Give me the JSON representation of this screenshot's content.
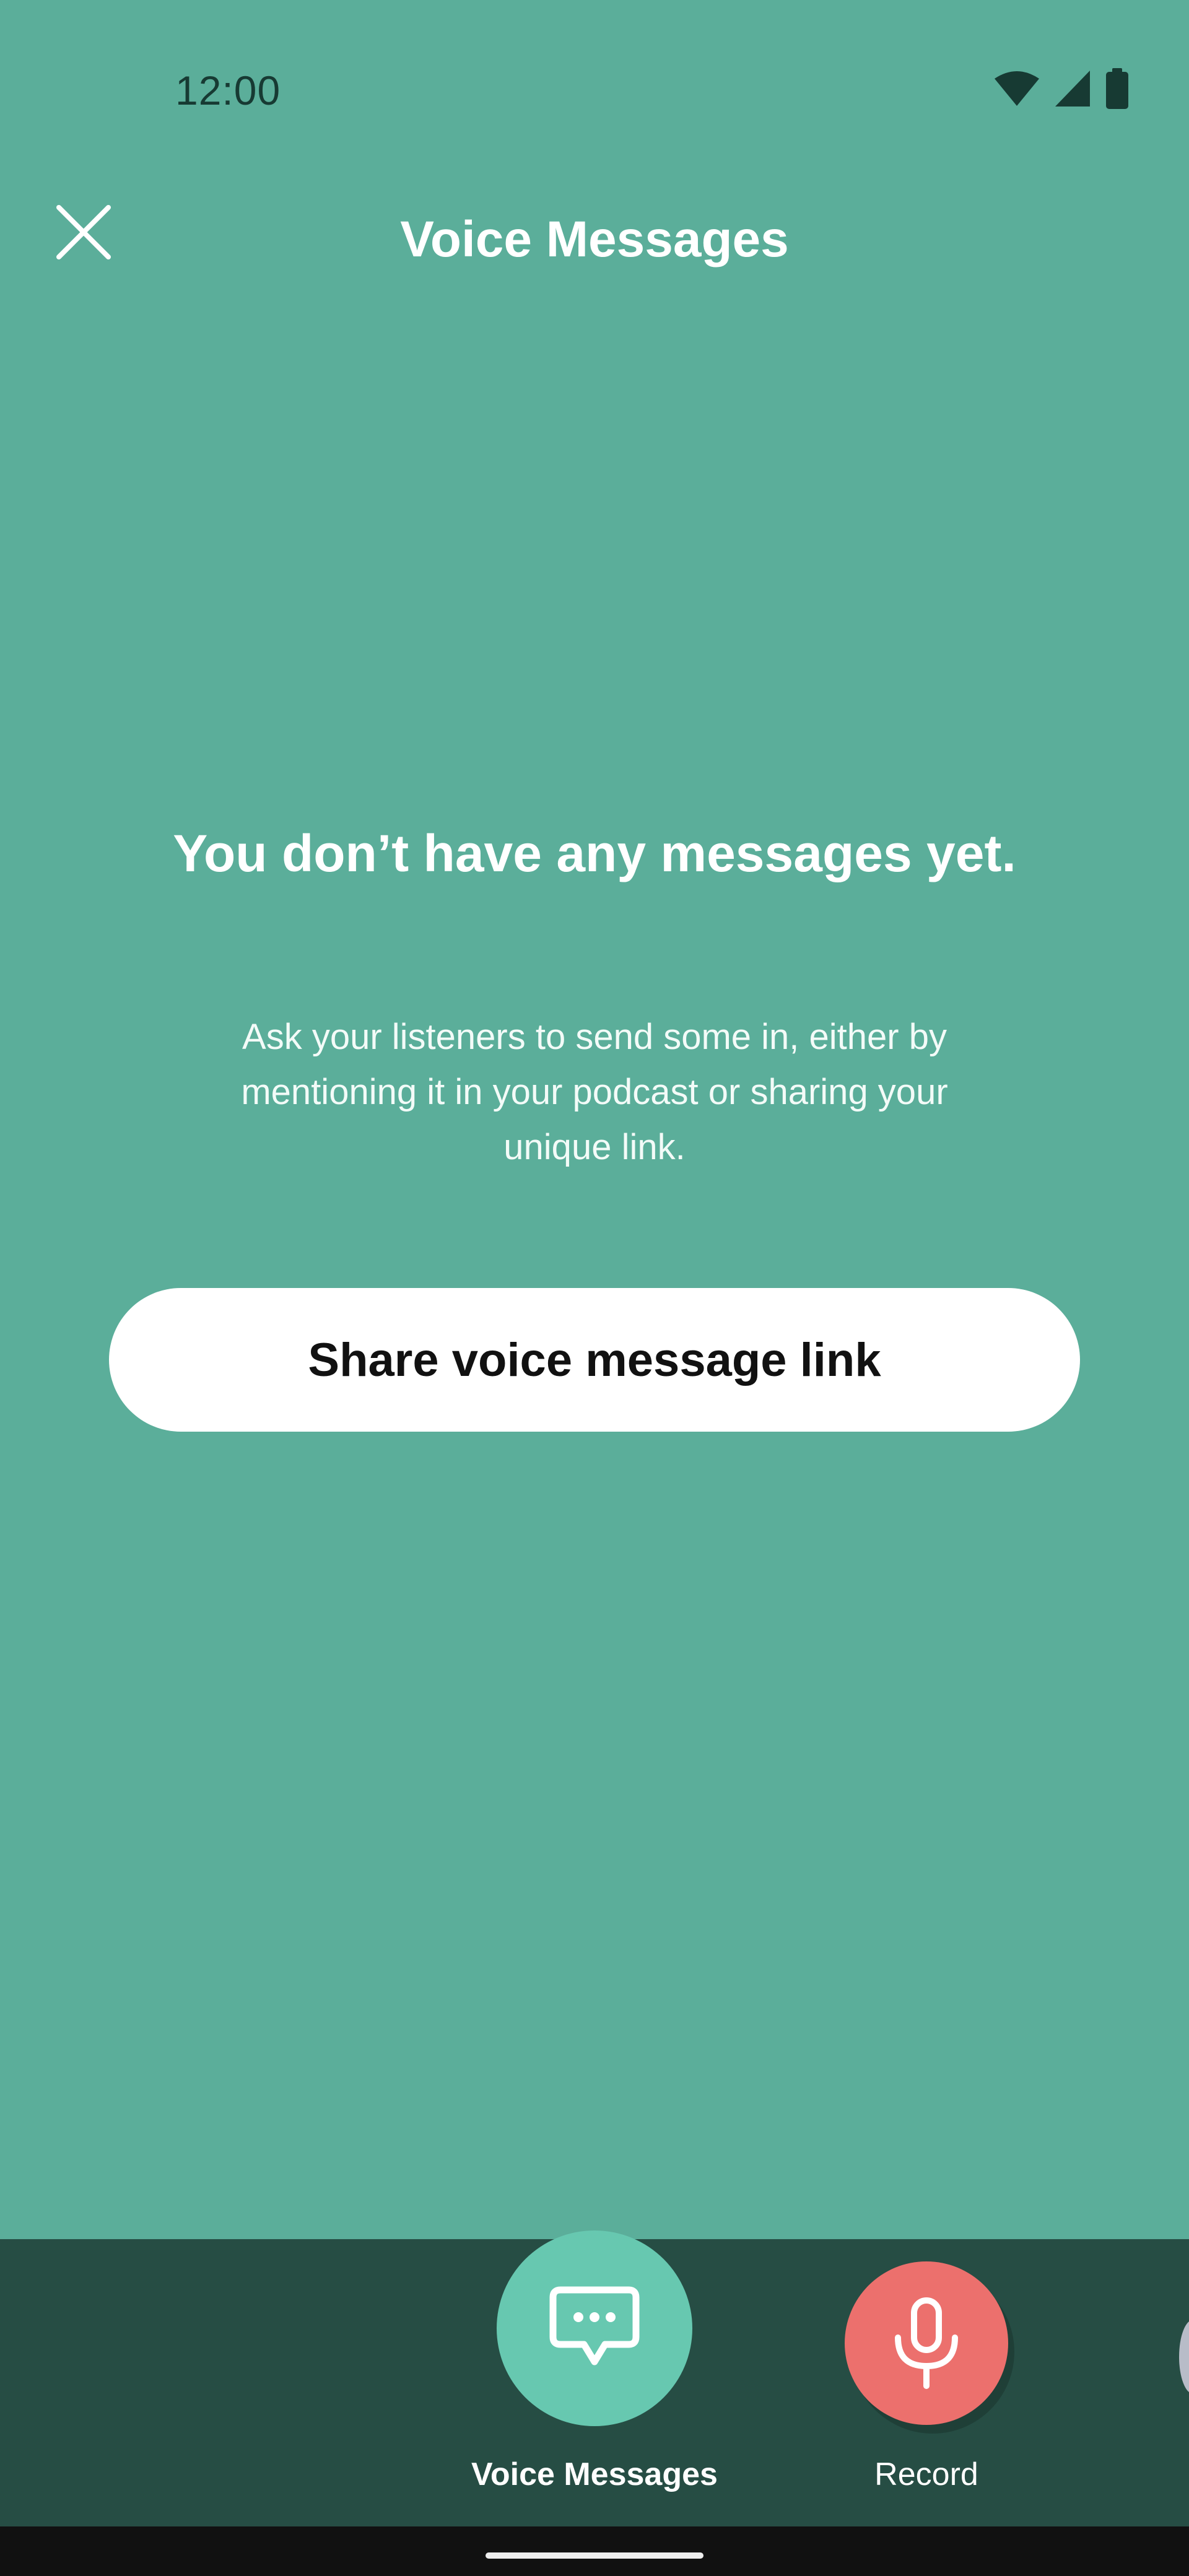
{
  "status_bar": {
    "time": "12:00",
    "icons": [
      "wifi-icon",
      "cellular-signal-icon",
      "battery-icon"
    ]
  },
  "header": {
    "title": "Voice Messages",
    "close_icon": "close-icon"
  },
  "empty_state": {
    "heading": "You don’t have any messages yet.",
    "body": "Ask your listeners to send some in, either by mentioning it in your podcast or sharing your unique link.",
    "button_label": "Share voice message link"
  },
  "bottom_nav": {
    "items": [
      {
        "label": "Voice Messages",
        "icon": "chat-bubble-icon",
        "active": true
      },
      {
        "label": "Record",
        "icon": "microphone-icon",
        "active": false
      }
    ]
  },
  "colors": {
    "background": "#5BAE9A",
    "bottom_bar": "#264D44",
    "voice_button": "#67C8B0",
    "record_button": "#EC706D",
    "status_text": "#173A33"
  }
}
